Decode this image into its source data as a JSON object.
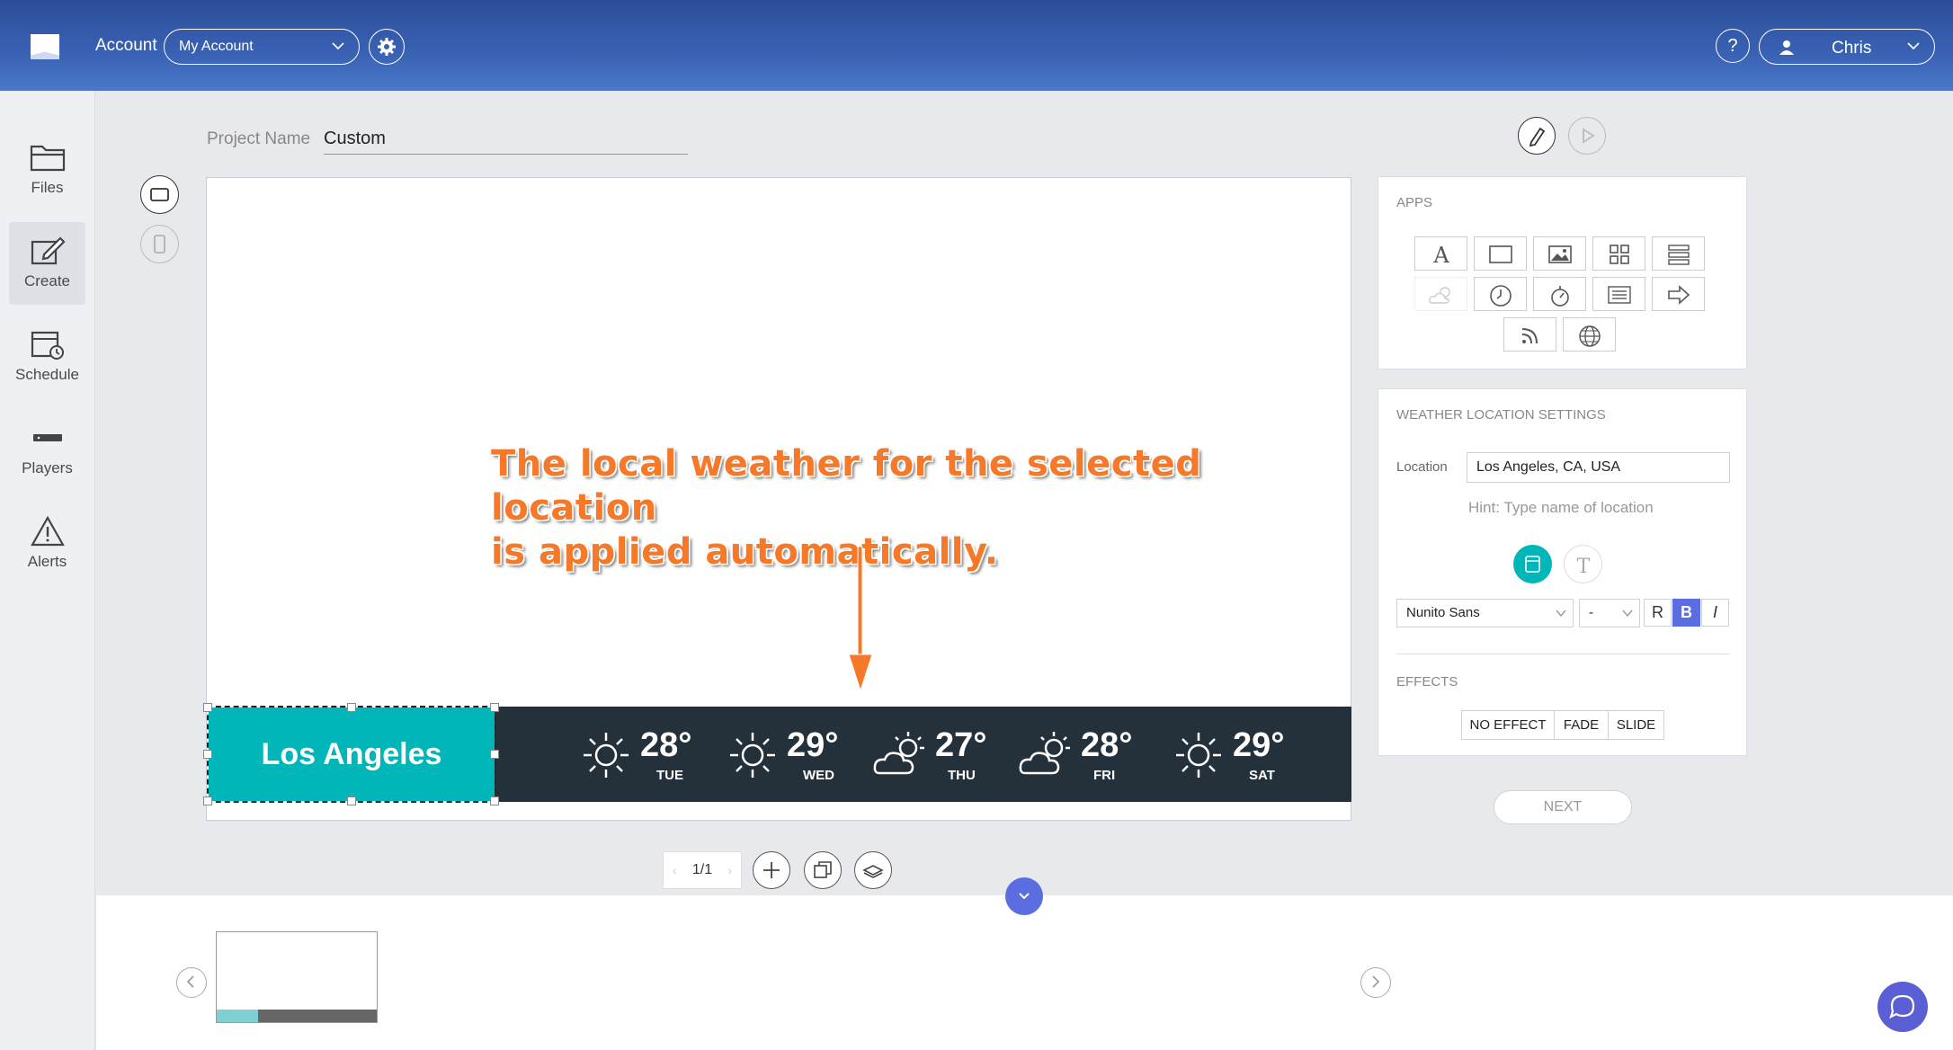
{
  "header": {
    "account_label": "Account",
    "account_value": "My Account",
    "help_label": "?",
    "user_name": "Chris"
  },
  "sidebar": {
    "items": [
      {
        "label": "Files",
        "icon": "folder-icon"
      },
      {
        "label": "Create",
        "icon": "edit-icon",
        "active": true
      },
      {
        "label": "Schedule",
        "icon": "calendar-clock-icon"
      },
      {
        "label": "Players",
        "icon": "player-icon"
      },
      {
        "label": "Alerts",
        "icon": "alert-icon"
      }
    ]
  },
  "project": {
    "label": "Project Name",
    "name": "Custom"
  },
  "canvas": {
    "annotation_line1": "The local weather for the selected location",
    "annotation_line2": "is applied automatically.",
    "city": "Los Angeles",
    "forecast": [
      {
        "temp": "28°",
        "day": "TUE",
        "icon": "sun-icon"
      },
      {
        "temp": "29°",
        "day": "WED",
        "icon": "sun-icon"
      },
      {
        "temp": "27°",
        "day": "THU",
        "icon": "partly-cloudy-icon"
      },
      {
        "temp": "28°",
        "day": "FRI",
        "icon": "partly-cloudy-icon"
      },
      {
        "temp": "29°",
        "day": "SAT",
        "icon": "sun-icon"
      }
    ]
  },
  "apps_panel": {
    "title": "APPS",
    "apps": [
      "text-app-icon",
      "shape-app-icon",
      "image-app-icon",
      "qr-app-icon",
      "list-app-icon",
      "weather-app-icon",
      "clock-app-icon",
      "timer-app-icon",
      "ticker-app-icon",
      "arrow-app-icon",
      "rss-app-icon",
      "web-app-icon"
    ]
  },
  "weather_settings": {
    "title": "WEATHER LOCATION SETTINGS",
    "location_label": "Location",
    "location_value": "Los Angeles, CA, USA",
    "hint": "Hint: Type name of location",
    "font_family": "Nunito Sans",
    "font_size": "-",
    "bold_regular": "R",
    "bold": "B",
    "italic": "I",
    "effects_title": "EFFECTS",
    "effects": [
      "NO EFFECT",
      "FADE",
      "SLIDE"
    ],
    "next": "NEXT"
  },
  "pager": {
    "value": "1/1",
    "prev": "‹",
    "next": "›"
  },
  "colors": {
    "header": "#3a62b4",
    "accent_teal": "#00b6b9",
    "weather_bar": "#25313a",
    "annotation": "#f6792a",
    "bold_active": "#5b6ee1"
  }
}
